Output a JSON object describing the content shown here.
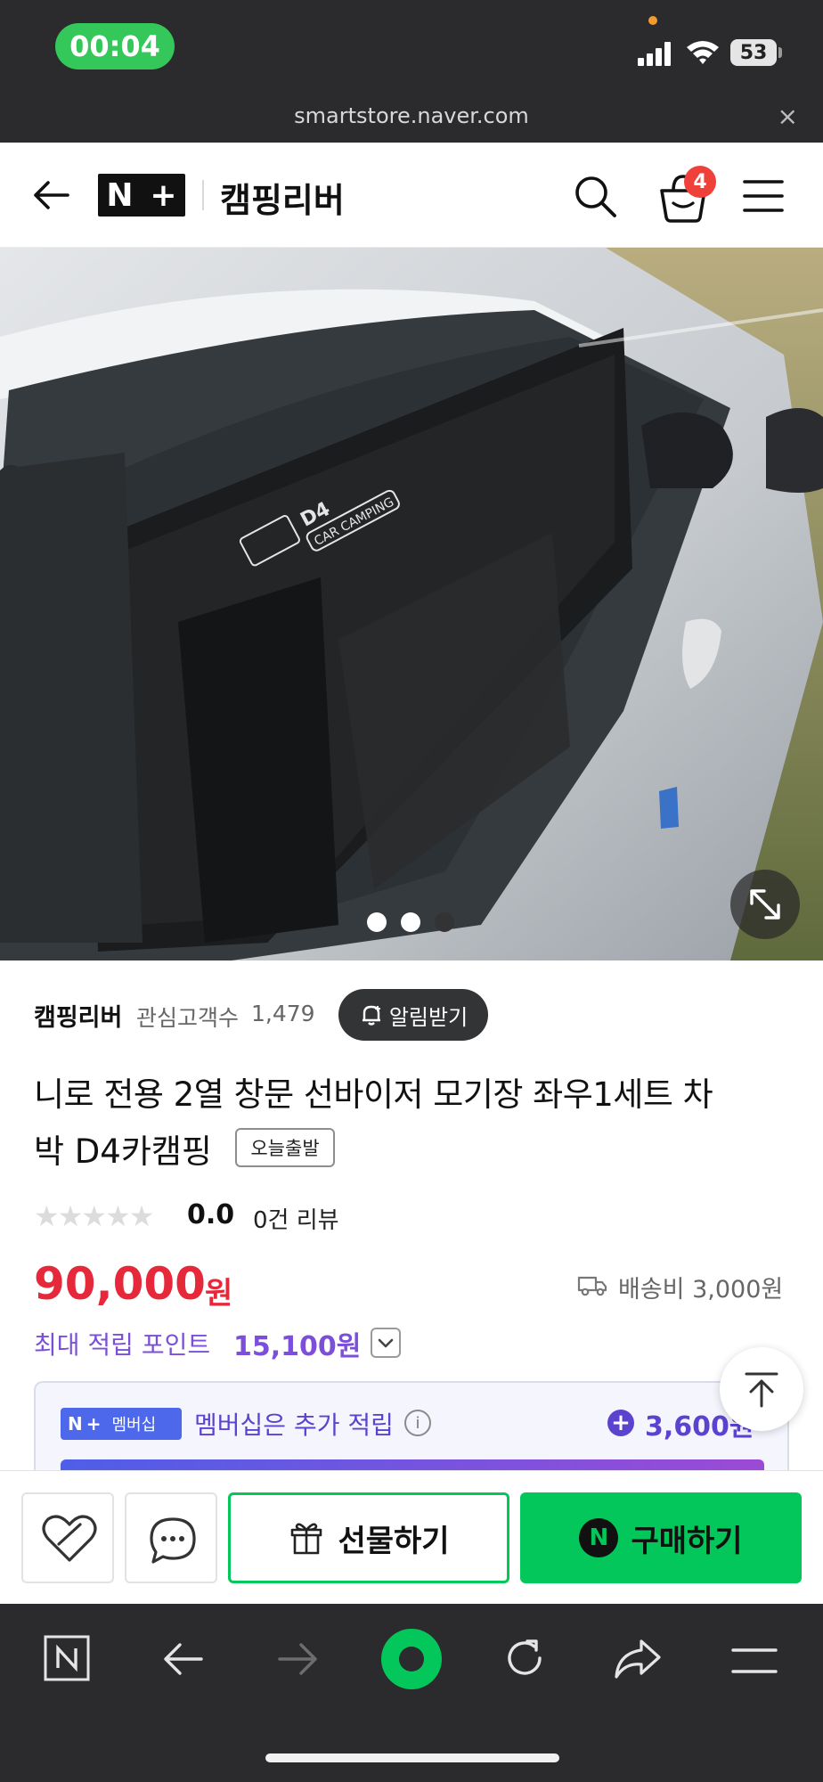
{
  "status_bar": {
    "time": "00:04",
    "battery": "53"
  },
  "url_bar": {
    "url": "smartstore.naver.com",
    "close": "×"
  },
  "header": {
    "logo_text": [
      "N",
      "+"
    ],
    "store_name": "캠핑리버",
    "cart_count": "4"
  },
  "gallery": {
    "image": "product-photo-car-window-sunshade",
    "total_images": 3,
    "active_index": 3,
    "print_text": "D4 CAR CAMPING"
  },
  "product": {
    "seller": "캠핑리버",
    "followers_label": "관심고객수",
    "followers_count": "1,479",
    "alarm_label": "알림받기",
    "title_line1": "니로 전용 2열 창문 선바이저 모기장 좌우1세트 차",
    "title_line2": "박 D4카캠핑",
    "today_badge": "오늘출발",
    "rating": "0.0",
    "review_count": "0건 리뷰",
    "stars_filled": 0,
    "price": "90,000",
    "price_unit": "원",
    "shipping": "배송비 3,000원",
    "points_label": "최대 적립 포인트",
    "points_value": "15,100원",
    "membership_badge": "멤버십",
    "membership_text": "멤버십은 추가 적립",
    "membership_amount": "3,600원"
  },
  "actions": {
    "gift_label": "선물하기",
    "buy_label": "구매하기",
    "buy_icon": "N"
  },
  "browser_toolbar": {
    "icons": [
      "naver-home-icon",
      "back-arrow-icon",
      "forward-arrow-icon",
      "green-dot-icon",
      "reload-icon",
      "share-icon",
      "menu-icon"
    ]
  },
  "colors": {
    "price": "#e5283a",
    "points": "#7b4fd9",
    "primary_green": "#03c75a",
    "badge_red": "#f0403a"
  }
}
